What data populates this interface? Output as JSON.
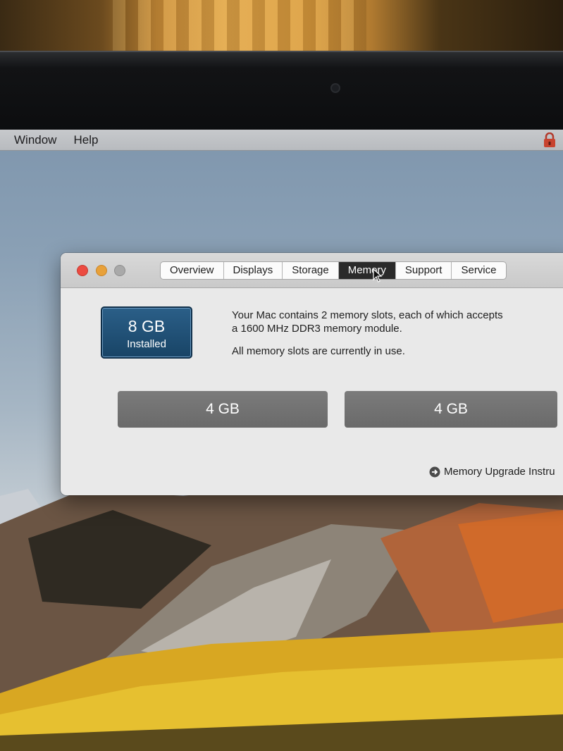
{
  "menubar": {
    "items": [
      "Window",
      "Help"
    ],
    "lock_icon": "lock-icon"
  },
  "window": {
    "tabs": [
      "Overview",
      "Displays",
      "Storage",
      "Memory",
      "Support",
      "Service"
    ],
    "active_tab": "Memory",
    "installed": {
      "size": "8 GB",
      "label": "Installed"
    },
    "info": {
      "line1": "Your Mac contains 2 memory slots, each of which accepts",
      "line2": "a 1600 MHz DDR3 memory module.",
      "status": "All memory slots are currently in use."
    },
    "slots": [
      "4 GB",
      "4 GB"
    ],
    "upgrade_link": "Memory Upgrade Instru"
  },
  "colors": {
    "installed_box": "#1f4f76",
    "slot": "#737373",
    "close": "#ec4b41",
    "minimize": "#e8a13a",
    "active_tab": "#2a2a2a"
  }
}
